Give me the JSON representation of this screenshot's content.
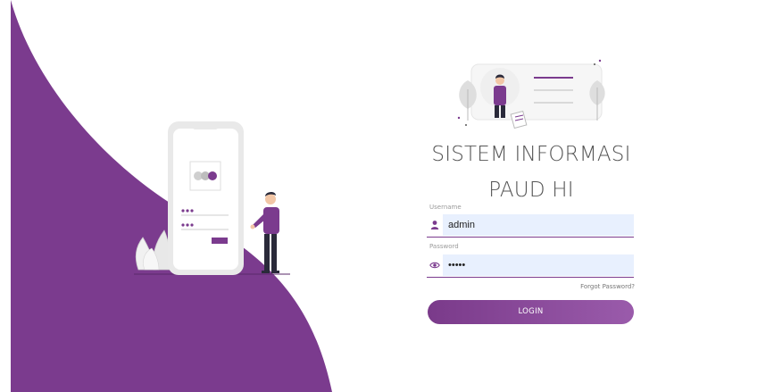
{
  "theme": {
    "accent": "#7b3b8e",
    "accent_light": "#9a5bab",
    "input_bg": "#e8f0fe"
  },
  "login_form": {
    "title_line1": "SISTEM INFORMASI",
    "title_line2": "PAUD HI",
    "username": {
      "label": "Username",
      "value": "admin",
      "icon": "user-icon"
    },
    "password": {
      "label": "Password",
      "value": "•••••",
      "icon": "eye-icon"
    },
    "forgot_password": "Forgot Password?",
    "login_button": "LOGIN"
  }
}
